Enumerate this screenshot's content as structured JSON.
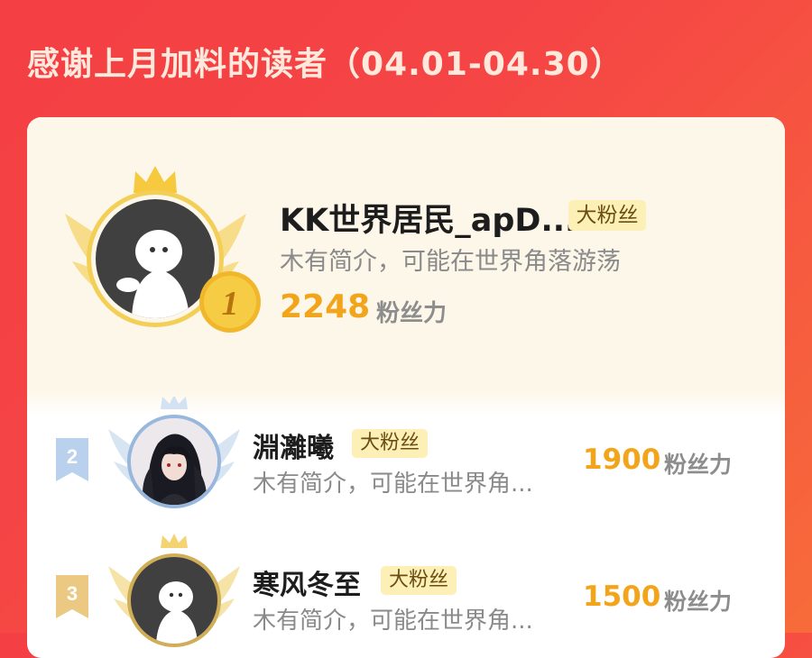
{
  "page": {
    "title": "感谢上月加料的读者（04.01-04.30）"
  },
  "colors": {
    "background_start": "#f43f44",
    "background_end": "#f76b3a",
    "title_text": "#ffe9dc",
    "card_top": "#fdf7e9",
    "points": "#f2a51a",
    "badge_bg": "#fdf0b6",
    "gold_medal": "#f5c43a",
    "silver_tag": "#a9c6e6",
    "bronze_tag": "#e8c77a"
  },
  "readers": [
    {
      "rank": "1",
      "name": "KK世界居民_apD...",
      "badge": "大粉丝",
      "bio": "木有简介，可能在世界角落游荡",
      "points": "2248",
      "points_unit": "粉丝力",
      "avatar_icon": "default-ghost-avatar",
      "medal_icon": "gold-medal-icon"
    },
    {
      "rank": "2",
      "name": "淵灕曦",
      "badge": "大粉丝",
      "bio": "木有简介，可能在世界角...",
      "points": "1900",
      "points_unit": "粉丝力",
      "avatar_icon": "anime-character-avatar",
      "medal_icon": "silver-rank-tag-icon"
    },
    {
      "rank": "3",
      "name": "寒风冬至",
      "badge": "大粉丝",
      "bio": "木有简介，可能在世界角...",
      "points": "1500",
      "points_unit": "粉丝力",
      "avatar_icon": "default-ghost-avatar",
      "medal_icon": "bronze-rank-tag-icon"
    }
  ]
}
